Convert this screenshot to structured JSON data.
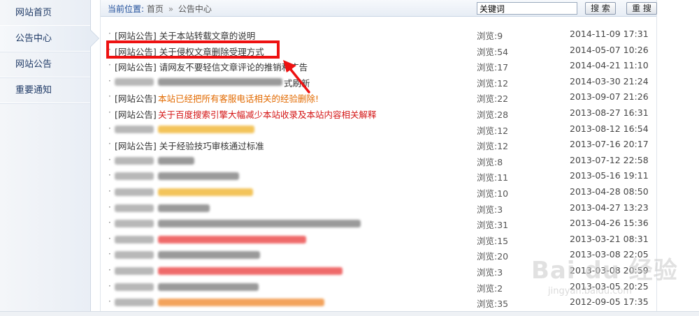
{
  "sidebar": {
    "items": [
      {
        "label": "网站首页"
      },
      {
        "label": "公告中心"
      },
      {
        "label": "网站公告"
      },
      {
        "label": "重要通知"
      }
    ]
  },
  "header": {
    "crumb_label": "当前位置:",
    "crumb_home": "首页",
    "crumb_sep": "»",
    "crumb_current": "公告中心",
    "search_value": "关键词",
    "search_button": "搜 索",
    "reset_button": "重 搜"
  },
  "list": {
    "rows": [
      {
        "title": "[网站公告] 关于本站转载文章的说明",
        "views": "浏览:9",
        "date": "2014-11-09 17:31"
      },
      {
        "title": "[网站公告] 关于侵权文章删除受理方式",
        "views": "浏览:54",
        "date": "2014-05-07 10:26"
      },
      {
        "title": "[网站公告] 请网友不要轻信文章评论的推销和广告",
        "views": "浏览:17",
        "date": "2014-04-21 11:10"
      },
      {
        "title": "式刷新",
        "views": "浏览:12",
        "date": "2014-03-30 21:24"
      },
      {
        "title": "[网站公告]",
        "title_colored": "本站已经把所有客服电话相关的经验删除!",
        "views": "浏览:22",
        "date": "2013-09-07 21:26"
      },
      {
        "title": "[网站公告]",
        "title_colored": "关于百度搜索引擎大幅减少本站收录及本站内容相关解释",
        "views": "浏览:28",
        "date": "2013-08-27 16:31"
      },
      {
        "title": "",
        "views": "浏览:12",
        "date": "2013-08-12 16:54"
      },
      {
        "title": "[网站公告] 关于经验技巧审核通过标准",
        "views": "浏览:12",
        "date": "2013-07-16 20:17"
      },
      {
        "title": "",
        "views": "浏览:8",
        "date": "2013-07-12 22:58"
      },
      {
        "title": "",
        "views": "浏览:11",
        "date": "2013-05-16 19:11"
      },
      {
        "title": "",
        "views": "浏览:10",
        "date": "2013-04-28 08:50"
      },
      {
        "title": "",
        "views": "浏览:3",
        "date": "2013-04-27 13:23"
      },
      {
        "title": "",
        "views": "浏览:31",
        "date": "2013-04-26 15:36"
      },
      {
        "title": "",
        "views": "浏览:15",
        "date": "2013-03-21 08:31"
      },
      {
        "title": "",
        "views": "浏览:20",
        "date": "2013-03-08 22:05"
      },
      {
        "title": "",
        "views": "浏览:3",
        "date": "2013-03-08 20:59"
      },
      {
        "title": "",
        "views": "浏览:2",
        "date": "2013-03-05 20:25"
      },
      {
        "title": "",
        "views": "浏览:35",
        "date": "2012-09-05 17:35"
      }
    ]
  },
  "watermark": {
    "main": "Bai du 经验",
    "sub": "jingyan.baidu.com"
  },
  "colors": {
    "accent": "#1f4e9a",
    "highlight": "#ee1111",
    "orange": "#e26a00",
    "red": "#d41616"
  }
}
